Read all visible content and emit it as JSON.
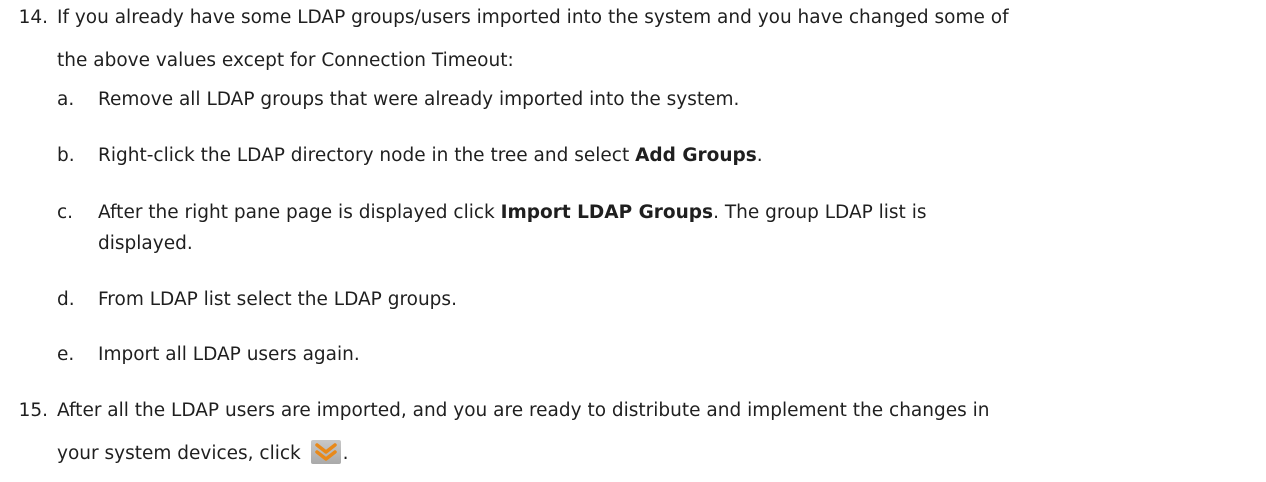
{
  "step14": {
    "number": "14.",
    "line1": "If you already have some LDAP groups/users imported into the system and you have changed some of",
    "line2": "the above values except for Connection Timeout:",
    "substeps": {
      "a": {
        "letter": "a.",
        "text": "Remove all LDAP groups that were already imported into the system."
      },
      "b": {
        "letter": "b.",
        "text_before": "Right-click the LDAP directory node in the tree and select ",
        "bold": "Add Groups",
        "text_after": "."
      },
      "c": {
        "letter": "c.",
        "text_before": "After the right pane page is displayed click ",
        "bold": "Import LDAP Groups",
        "text_after": ". The group LDAP list is",
        "line2": "displayed."
      },
      "d": {
        "letter": "d.",
        "text": "From LDAP list select the LDAP groups."
      },
      "e": {
        "letter": "e.",
        "text": "Import all LDAP users again."
      }
    }
  },
  "step15": {
    "number": "15.",
    "line1": "After all the LDAP users are imported, and you are ready to distribute and implement the changes in",
    "line2_before": "your system devices, click ",
    "line2_after": ".",
    "icon": "distribute-changes-icon"
  },
  "colors": {
    "text": "#1f1f1f",
    "icon_orange": "#e8891a",
    "icon_bg": "#b4b4b4"
  }
}
